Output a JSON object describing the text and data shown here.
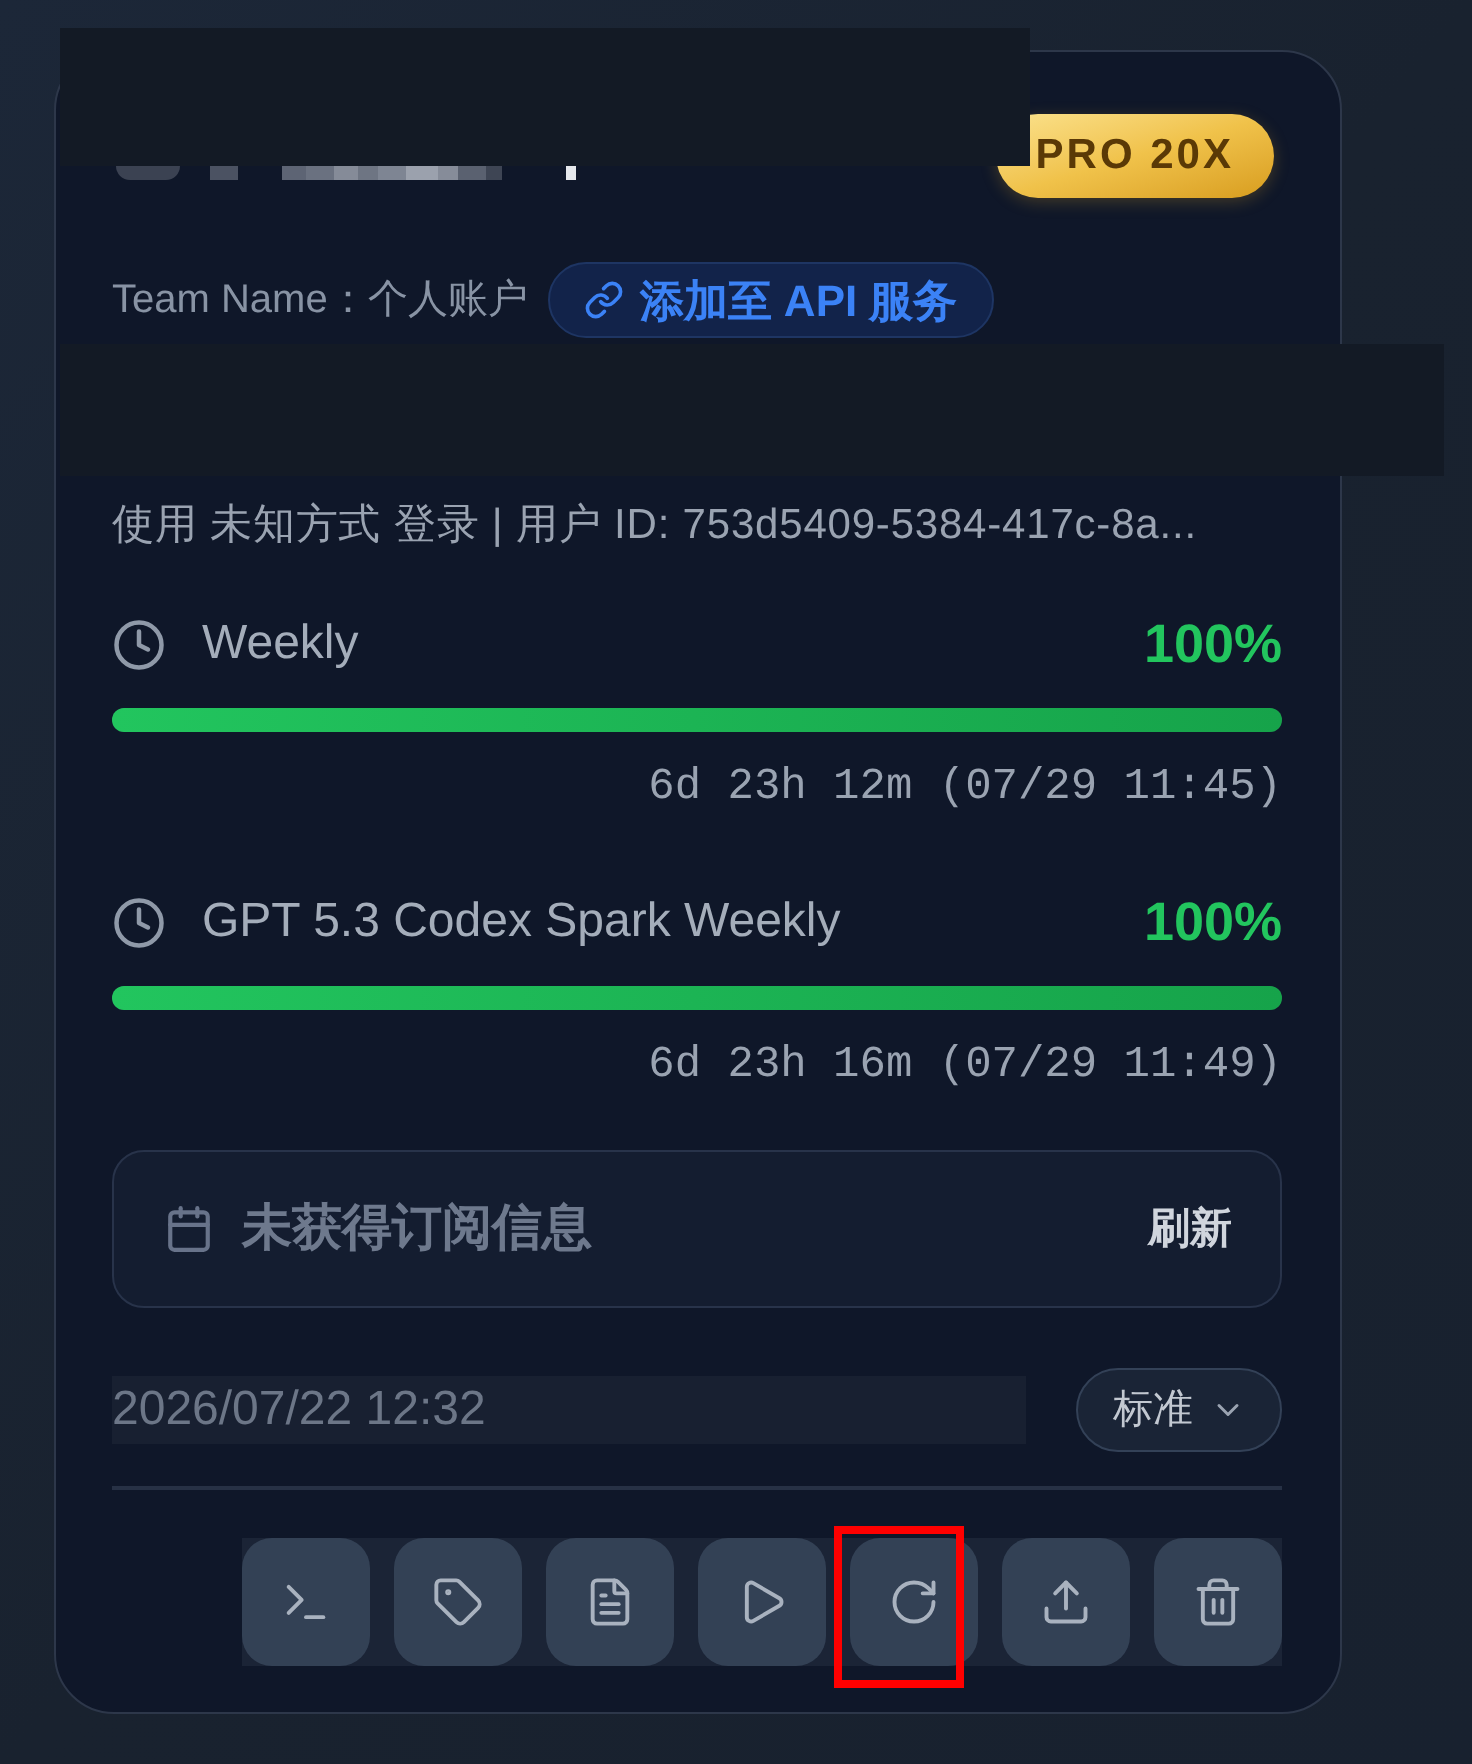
{
  "header": {
    "badge": "PRO 20X"
  },
  "team": {
    "label": "Team Name：个人账户",
    "action": "添加至 API 服务"
  },
  "login_info": "使用 未知方式 登录 | 用户 ID: 753d5409-5384-417c-8a...",
  "quotas": [
    {
      "label": "Weekly",
      "percent": "100%",
      "level": 1,
      "reset": "6d 23h 12m (07/29 11:45)"
    },
    {
      "label": "GPT 5.3 Codex Spark Weekly",
      "percent": "100%",
      "level": 1,
      "reset": "6d 23h 16m (07/29 11:49)"
    }
  ],
  "subscription": {
    "message": "未获得订阅信息",
    "action": "刷新"
  },
  "footer": {
    "date": "2026/07/22 12:32",
    "mode_select": {
      "value": "标准"
    }
  },
  "actions": [
    {
      "kind": "terminal",
      "highlighted": false
    },
    {
      "kind": "tag",
      "highlighted": false
    },
    {
      "kind": "document",
      "highlighted": false
    },
    {
      "kind": "play",
      "highlighted": false
    },
    {
      "kind": "refresh",
      "highlighted": true
    },
    {
      "kind": "upload",
      "highlighted": false
    },
    {
      "kind": "delete",
      "highlighted": false
    }
  ]
}
